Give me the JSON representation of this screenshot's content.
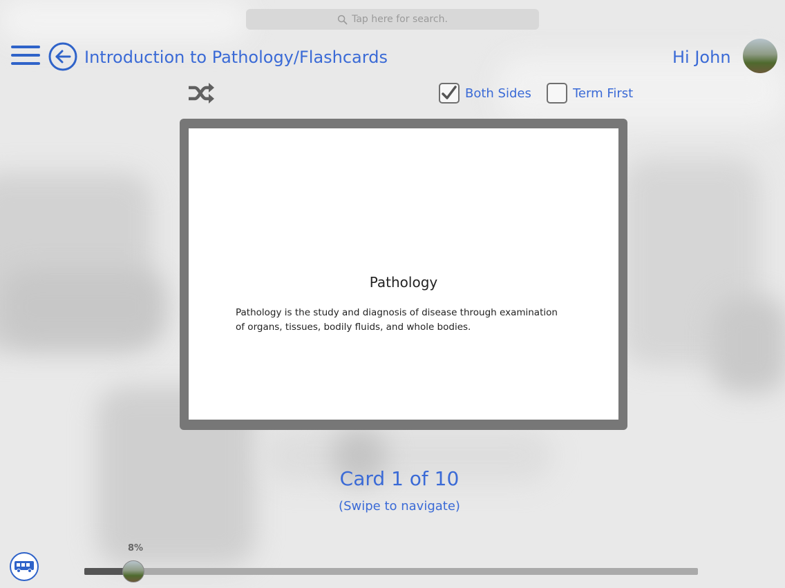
{
  "search": {
    "placeholder": "Tap here for search.",
    "icon": "search-icon"
  },
  "header": {
    "title": "Introduction to Pathology/Flashcards",
    "greeting": "Hi John",
    "accent_color": "#3a6ad6"
  },
  "options": {
    "both_sides": {
      "label": "Both Sides",
      "checked": true
    },
    "term_first": {
      "label": "Term First",
      "checked": false
    }
  },
  "card": {
    "term": "Pathology",
    "definition": "Pathology is the study and diagnosis of disease through examination of organs, tissues, bodily fluids, and whole bodies."
  },
  "navigation": {
    "counter": "Card 1 of 10",
    "hint": "(Swipe to navigate)"
  },
  "progress": {
    "label": "8%",
    "fraction": 0.08
  }
}
